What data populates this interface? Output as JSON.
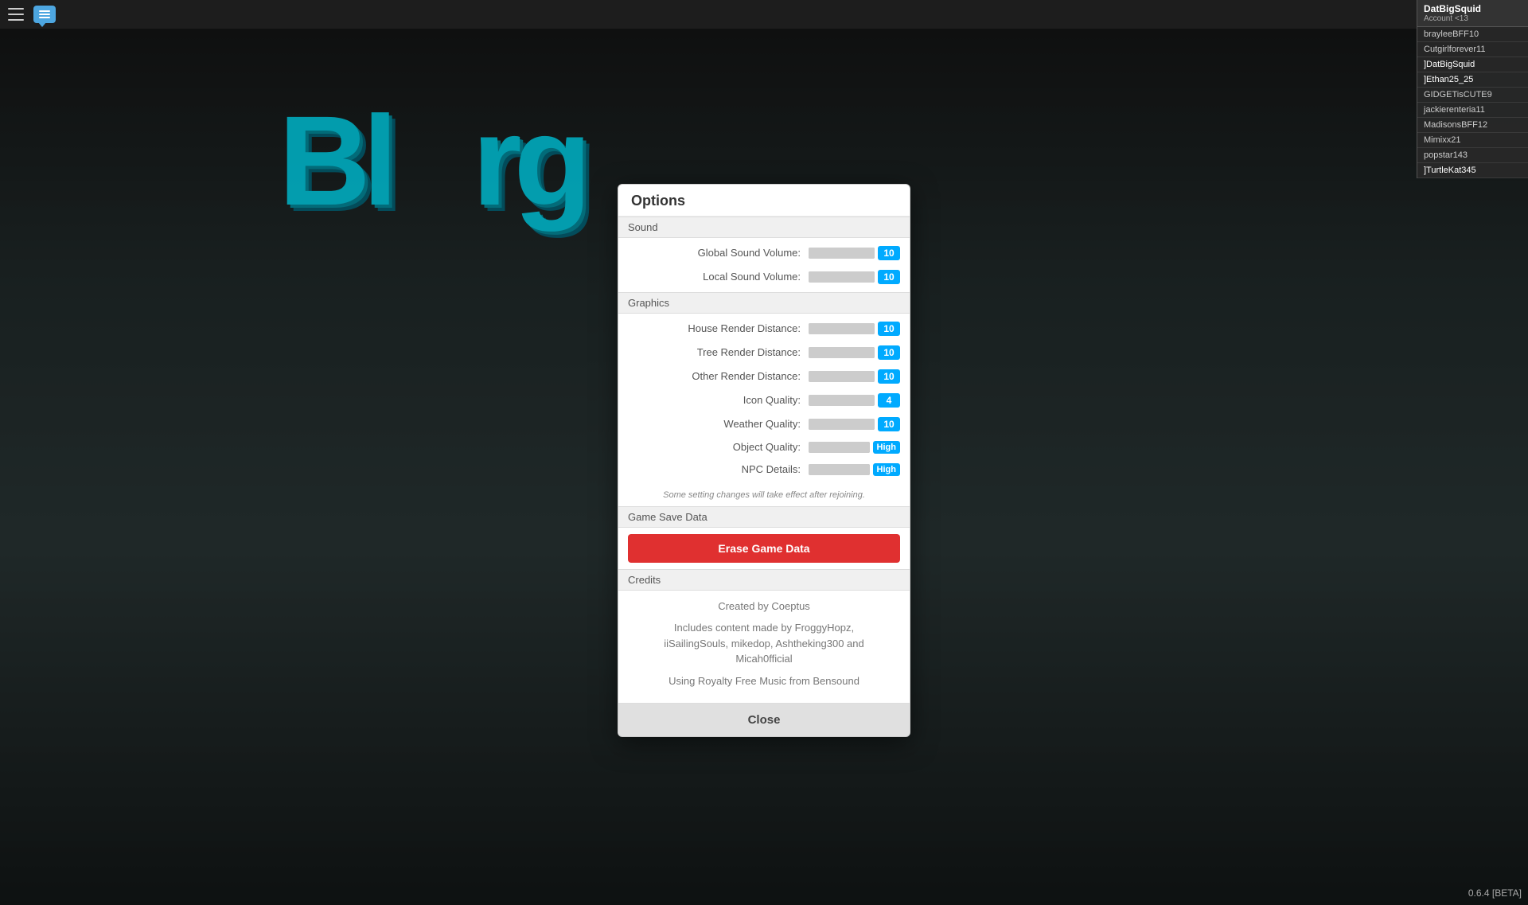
{
  "app": {
    "version": "0.6.4 [BETA]"
  },
  "topbar": {
    "hamburger_label": "Menu",
    "chat_label": "Chat"
  },
  "account": {
    "username": "DatBigSquid",
    "subtitle": "Account <13",
    "players": [
      {
        "name": "brayleeBFF10",
        "is_local": false
      },
      {
        "name": "Cutgirlforever11",
        "is_local": false
      },
      {
        "name": "] DatBigSquid",
        "is_local": true
      },
      {
        "name": "] Ethan25_25",
        "is_local": false
      },
      {
        "name": "GIDGETisCUTE9",
        "is_local": false
      },
      {
        "name": "jackierenteria11",
        "is_local": false
      },
      {
        "name": "MadisonsBFF12",
        "is_local": false
      },
      {
        "name": "Mimixx21",
        "is_local": false
      },
      {
        "name": "popstar143",
        "is_local": false
      },
      {
        "name": "] TurtleKat345",
        "is_local": false
      }
    ]
  },
  "modal": {
    "title": "Options",
    "sections": {
      "sound": {
        "header": "Sound",
        "settings": [
          {
            "label": "Global Sound Volume:",
            "value": "10",
            "type": "number"
          },
          {
            "label": "Local Sound Volume:",
            "value": "10",
            "type": "number"
          }
        ]
      },
      "graphics": {
        "header": "Graphics",
        "settings": [
          {
            "label": "House Render Distance:",
            "value": "10",
            "type": "number"
          },
          {
            "label": "Tree Render Distance:",
            "value": "10",
            "type": "number"
          },
          {
            "label": "Other Render Distance:",
            "value": "10",
            "type": "number"
          },
          {
            "label": "Icon Quality:",
            "value": "4",
            "type": "number"
          },
          {
            "label": "Weather Quality:",
            "value": "10",
            "type": "number"
          },
          {
            "label": "Object Quality:",
            "value": "High",
            "type": "text"
          },
          {
            "label": "NPC Details:",
            "value": "High",
            "type": "text"
          }
        ]
      },
      "notice": "Some setting changes will take effect after rejoining.",
      "game_save": {
        "header": "Game Save Data",
        "erase_button": "Erase Game Data"
      },
      "credits": {
        "header": "Credits",
        "lines": [
          "Created by Coeptus",
          "Includes content made by FroggyHopz,\niiSailingSouls, mikedop, Ashtheking300 and\nMicah0fficial",
          "Using Royalty Free Music from Bensound"
        ]
      }
    },
    "close_button": "Close"
  }
}
